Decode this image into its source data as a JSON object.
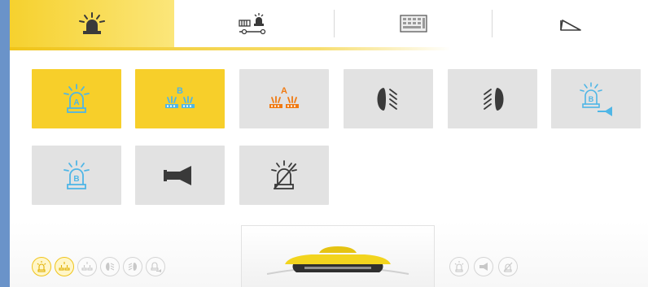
{
  "colors": {
    "accent_yellow": "#f7cf2a",
    "tile_grey": "#e2e2e2",
    "icon_blue": "#4fb6e6",
    "icon_orange": "#f07a12",
    "icon_dark": "#3a3a3a",
    "side_strip": "#6a93c9"
  },
  "tabs": [
    {
      "icon": "beacon-icon",
      "active": true
    },
    {
      "icon": "trailer-beacon-icon",
      "active": false
    },
    {
      "icon": "keypad-icon",
      "active": false
    },
    {
      "icon": "ramp-icon",
      "active": false
    }
  ],
  "tiles": [
    {
      "icon": "beacon-a-icon",
      "state": "on",
      "label": "A"
    },
    {
      "icon": "lightbar-b-icon",
      "state": "on",
      "label": "B"
    },
    {
      "icon": "lightbar-a-icon",
      "state": "off",
      "label": "A"
    },
    {
      "icon": "headlight-left-icon",
      "state": "off"
    },
    {
      "icon": "headlight-right-icon",
      "state": "off"
    },
    {
      "icon": "beacon-b-horn-icon",
      "state": "off",
      "label": "B"
    },
    {
      "icon": "beacon-b-icon",
      "state": "off",
      "label": "B"
    },
    {
      "icon": "horn-icon",
      "state": "off"
    },
    {
      "icon": "beacon-off-icon",
      "state": "off"
    }
  ],
  "status_icons_left": [
    {
      "icon": "beacon-a-icon",
      "state": "on"
    },
    {
      "icon": "lightbar-b-icon",
      "state": "on"
    },
    {
      "icon": "lightbar-a-icon",
      "state": "off"
    },
    {
      "icon": "headlight-left-icon",
      "state": "off"
    },
    {
      "icon": "headlight-right-icon",
      "state": "off"
    },
    {
      "icon": "beacon-b-horn-icon",
      "state": "off"
    }
  ],
  "status_icons_right": [
    {
      "icon": "beacon-b-icon",
      "state": "off"
    },
    {
      "icon": "horn-icon",
      "state": "off"
    },
    {
      "icon": "beacon-off-icon",
      "state": "off"
    }
  ],
  "center_preview": {
    "icon": "lightbar-preview-icon"
  }
}
